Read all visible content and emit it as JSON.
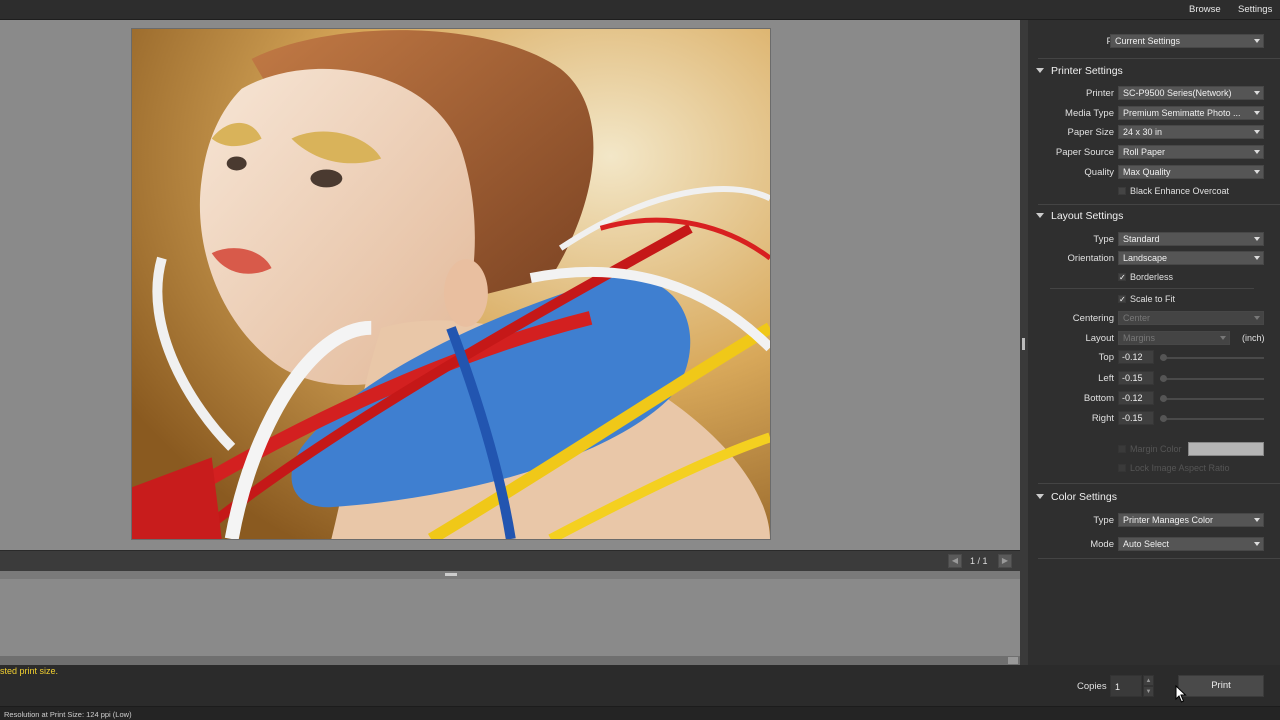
{
  "topbar": {
    "browse": "Browse",
    "settings": "Settings"
  },
  "preview": {
    "page_indicator": "1 / 1",
    "image_alt": "portrait-photo"
  },
  "panel": {
    "preset": {
      "label": "Preset",
      "value": "Current Settings"
    },
    "printer_settings": {
      "title": "Printer Settings",
      "printer": {
        "label": "Printer",
        "value": "SC-P9500 Series(Network)"
      },
      "media_type": {
        "label": "Media Type",
        "value": "Premium Semimatte Photo ..."
      },
      "paper_size": {
        "label": "Paper Size",
        "value": "24 x 30 in"
      },
      "paper_source": {
        "label": "Paper Source",
        "value": "Roll Paper"
      },
      "quality": {
        "label": "Quality",
        "value": "Max Quality"
      },
      "black_enhance": {
        "label": "Black Enhance Overcoat",
        "checked": false
      }
    },
    "layout_settings": {
      "title": "Layout Settings",
      "type": {
        "label": "Type",
        "value": "Standard"
      },
      "orientation": {
        "label": "Orientation",
        "value": "Landscape"
      },
      "borderless": {
        "label": "Borderless",
        "checked": true
      },
      "scale_to_fit": {
        "label": "Scale to Fit",
        "checked": true
      },
      "centering": {
        "label": "Centering",
        "value": "Center"
      },
      "layout": {
        "label": "Layout",
        "value": "Margins",
        "unit": "(inch)"
      },
      "top": {
        "label": "Top",
        "value": "-0.12"
      },
      "left": {
        "label": "Left",
        "value": "-0.15"
      },
      "bottom": {
        "label": "Bottom",
        "value": "-0.12"
      },
      "right": {
        "label": "Right",
        "value": "-0.15"
      },
      "margin_color": {
        "label": "Margin Color",
        "checked": false
      },
      "lock_aspect": {
        "label": "Lock Image Aspect Ratio",
        "checked": false
      }
    },
    "color_settings": {
      "title": "Color Settings",
      "type": {
        "label": "Type",
        "value": "Printer Manages Color"
      },
      "mode": {
        "label": "Mode",
        "value": "Auto Select"
      }
    }
  },
  "bottom": {
    "warning": "sted print size.",
    "copies_label": "Copies",
    "copies_value": "1",
    "print_label": "Print",
    "status": "Resolution at Print Size: 124 ppi (Low)"
  },
  "colors": {
    "warning": "#f2d030",
    "panel_bg": "#2f2f2f",
    "preview_bg": "#8a8a8a"
  }
}
